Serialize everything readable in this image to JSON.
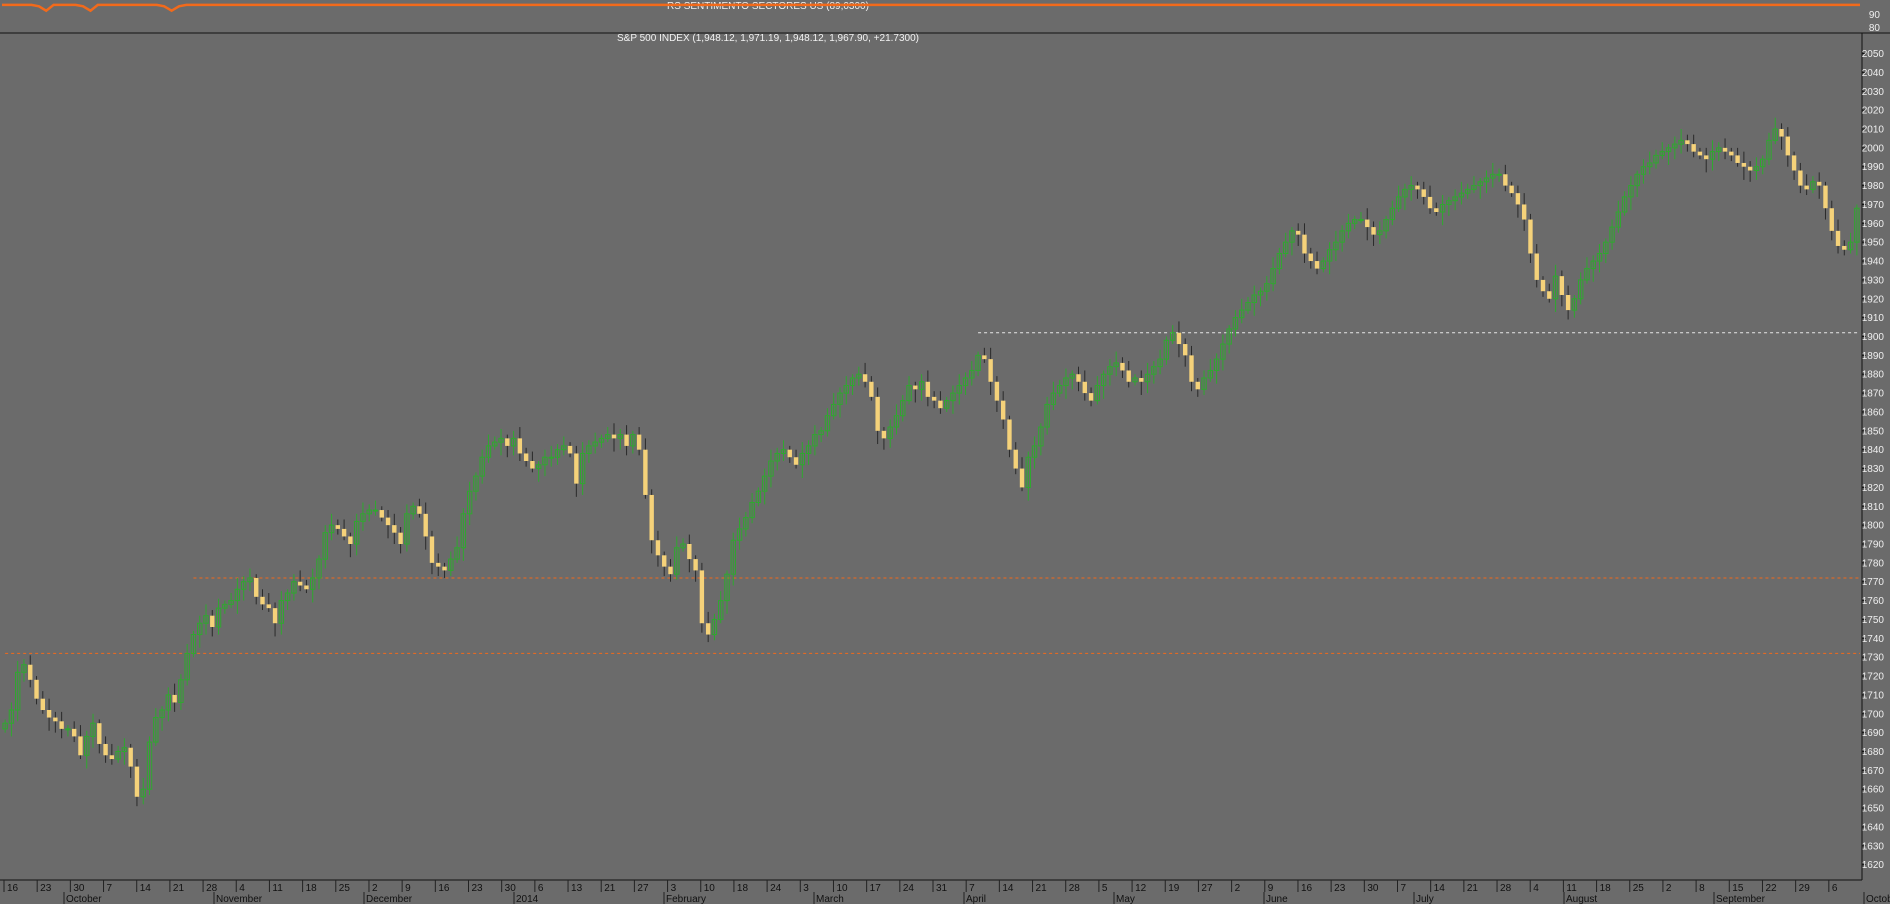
{
  "colors": {
    "background": "#6b6b6b",
    "up_candle": "#2fa82f",
    "down_candle": "#f5d27a",
    "indicator_line": "#f26a1b",
    "reference_orange": "#f26a1b",
    "reference_white": "#e8e8e8"
  },
  "indicator": {
    "title": "RS SENTIMENTO SECTORES US (89,0300)",
    "ticks": [
      "90",
      "80"
    ]
  },
  "chart_data": [
    {
      "type": "line",
      "title": "RS SENTIMENTO SECTORES US (89,0300)",
      "ylim": [
        78,
        98
      ],
      "yticks": [
        90,
        80
      ],
      "grid": false,
      "values": [
        96,
        96,
        96,
        96,
        96,
        95,
        92,
        96,
        96,
        96,
        96,
        95,
        92,
        96,
        96,
        96,
        96,
        96,
        96,
        96,
        96,
        96,
        95,
        92,
        95,
        96,
        96,
        96,
        96,
        96,
        96,
        96,
        96,
        96,
        96,
        96,
        96,
        96,
        96,
        96,
        96,
        96,
        96,
        96,
        96,
        96,
        96,
        96,
        96,
        96,
        96,
        96,
        96,
        96,
        96,
        96,
        96,
        96,
        96,
        96,
        96,
        96,
        96,
        96,
        96,
        96,
        96,
        96,
        96,
        96,
        96,
        96,
        96,
        96,
        96,
        96,
        96,
        96,
        96,
        96,
        96,
        96,
        96,
        96,
        96,
        96,
        96,
        96,
        96,
        96,
        96,
        96,
        96,
        96,
        96,
        96,
        96,
        96,
        96,
        96,
        96,
        96,
        96,
        96,
        96,
        96,
        96,
        96,
        96,
        96,
        96,
        96,
        96,
        96,
        96,
        96,
        96,
        96,
        96,
        96,
        96,
        96,
        96,
        96,
        96,
        96,
        96,
        96,
        96,
        96,
        96,
        96,
        96,
        96,
        96,
        96,
        96,
        96,
        96,
        96,
        96,
        96,
        96,
        96,
        96,
        96,
        96,
        96,
        96,
        96,
        96,
        96,
        96,
        96,
        96,
        96,
        96,
        96,
        96,
        96,
        96,
        96,
        96,
        96,
        96,
        96,
        96,
        96,
        96,
        96,
        96,
        96,
        96,
        96,
        96,
        96,
        96,
        96,
        96,
        96,
        96,
        96,
        96,
        96,
        96,
        96,
        96,
        96,
        96,
        96,
        96,
        96,
        96,
        96,
        96,
        96,
        96,
        96,
        96,
        96,
        96,
        96,
        96,
        96,
        96,
        96,
        96,
        96,
        96,
        96,
        96,
        96,
        96,
        96,
        96,
        96,
        96,
        96,
        96,
        96,
        96,
        96,
        96,
        96,
        96,
        96,
        96,
        96,
        96,
        96,
        96,
        96,
        96,
        96,
        96,
        96,
        96,
        96,
        96,
        96,
        96,
        96,
        96,
        96,
        96,
        96,
        96,
        96,
        96,
        96,
        96,
        96,
        96
      ]
    },
    {
      "type": "candlestick",
      "title": "S&P 500 INDEX (1,948.12, 1,971.19, 1,948.12, 1,967.90, +21.7300)",
      "ylim": [
        1614,
        2054
      ],
      "yticks": [
        2050,
        2040,
        2030,
        2020,
        2010,
        2000,
        1990,
        1980,
        1970,
        1960,
        1950,
        1940,
        1930,
        1920,
        1910,
        1900,
        1890,
        1880,
        1870,
        1860,
        1850,
        1840,
        1830,
        1820,
        1810,
        1800,
        1790,
        1780,
        1770,
        1760,
        1750,
        1740,
        1730,
        1720,
        1710,
        1700,
        1690,
        1680,
        1670,
        1660,
        1650,
        1640,
        1630,
        1620
      ],
      "grid": false,
      "reference_lines": [
        {
          "value": 1902,
          "style": "dotted",
          "color": "#e8e8e8",
          "from_index": 155
        },
        {
          "value": 1772,
          "style": "dotted",
          "color": "#f26a1b",
          "from_index": 30
        },
        {
          "value": 1732,
          "style": "dotted",
          "color": "#f26a1b",
          "from_index": 0
        }
      ],
      "date_ticks": [
        "16",
        "23",
        "30",
        "7",
        "14",
        "21",
        "28",
        "4",
        "11",
        "18",
        "25",
        "2",
        "9",
        "16",
        "23",
        "30",
        "6",
        "13",
        "21",
        "27",
        "3",
        "10",
        "18",
        "24",
        "3",
        "10",
        "17",
        "24",
        "31",
        "7",
        "14",
        "21",
        "28",
        "5",
        "12",
        "19",
        "27",
        "2",
        "9",
        "16",
        "23",
        "30",
        "7",
        "14",
        "21",
        "28",
        "4",
        "11",
        "18",
        "25",
        "2",
        "8",
        "15",
        "22",
        "29",
        "6"
      ],
      "months": [
        "October",
        "November",
        "December",
        "2014",
        "February",
        "March",
        "April",
        "May",
        "June",
        "July",
        "August",
        "September",
        "October"
      ],
      "close": [
        1695,
        1702,
        1722,
        1726,
        1718,
        1708,
        1702,
        1698,
        1696,
        1692,
        1692,
        1688,
        1678,
        1688,
        1695,
        1684,
        1678,
        1676,
        1680,
        1682,
        1672,
        1656,
        1660,
        1685,
        1698,
        1702,
        1710,
        1706,
        1718,
        1732,
        1742,
        1748,
        1752,
        1746,
        1756,
        1758,
        1760,
        1766,
        1770,
        1772,
        1762,
        1758,
        1756,
        1748,
        1760,
        1764,
        1770,
        1768,
        1766,
        1772,
        1782,
        1796,
        1800,
        1798,
        1794,
        1790,
        1802,
        1806,
        1808,
        1808,
        1804,
        1800,
        1796,
        1790,
        1806,
        1810,
        1806,
        1794,
        1780,
        1778,
        1776,
        1782,
        1788,
        1806,
        1818,
        1826,
        1836,
        1842,
        1844,
        1846,
        1842,
        1846,
        1838,
        1834,
        1830,
        1832,
        1836,
        1836,
        1840,
        1842,
        1838,
        1822,
        1838,
        1842,
        1844,
        1846,
        1848,
        1846,
        1848,
        1842,
        1848,
        1840,
        1816,
        1792,
        1784,
        1778,
        1774,
        1788,
        1790,
        1782,
        1776,
        1748,
        1742,
        1750,
        1760,
        1774,
        1792,
        1798,
        1804,
        1812,
        1818,
        1826,
        1834,
        1838,
        1840,
        1836,
        1832,
        1838,
        1842,
        1848,
        1850,
        1858,
        1864,
        1870,
        1874,
        1878,
        1880,
        1876,
        1868,
        1850,
        1846,
        1852,
        1858,
        1866,
        1874,
        1872,
        1876,
        1868,
        1866,
        1862,
        1866,
        1870,
        1874,
        1878,
        1882,
        1890,
        1888,
        1876,
        1866,
        1856,
        1840,
        1830,
        1820,
        1836,
        1842,
        1852,
        1864,
        1870,
        1874,
        1878,
        1880,
        1876,
        1870,
        1866,
        1874,
        1880,
        1884,
        1886,
        1882,
        1876,
        1878,
        1876,
        1880,
        1884,
        1888,
        1898,
        1902,
        1896,
        1890,
        1876,
        1872,
        1878,
        1882,
        1888,
        1896,
        1904,
        1910,
        1914,
        1918,
        1922,
        1924,
        1928,
        1936,
        1944,
        1950,
        1956,
        1954,
        1944,
        1940,
        1936,
        1940,
        1946,
        1950,
        1956,
        1960,
        1962,
        1962,
        1958,
        1954,
        1956,
        1962,
        1968,
        1974,
        1978,
        1980,
        1978,
        1974,
        1968,
        1966,
        1970,
        1972,
        1974,
        1976,
        1978,
        1980,
        1982,
        1984,
        1986,
        1986,
        1980,
        1976,
        1970,
        1962,
        1944,
        1930,
        1924,
        1920,
        1932,
        1922,
        1914,
        1920,
        1930,
        1936,
        1940,
        1944,
        1950,
        1958,
        1966,
        1974,
        1980,
        1986,
        1990,
        1992,
        1996,
        1998,
        2000,
        2002,
        2004,
        2002,
        1998,
        1996,
        1994,
        1998,
        2000,
        1998,
        1996,
        1992,
        1990,
        1988,
        1990,
        1994,
        2004,
        2010,
        2006,
        1996,
        1988,
        1980,
        1978,
        1982,
        1980,
        1968,
        1956,
        1948,
        1946,
        1950,
        1968
      ],
      "range_top_index": 240
    }
  ]
}
